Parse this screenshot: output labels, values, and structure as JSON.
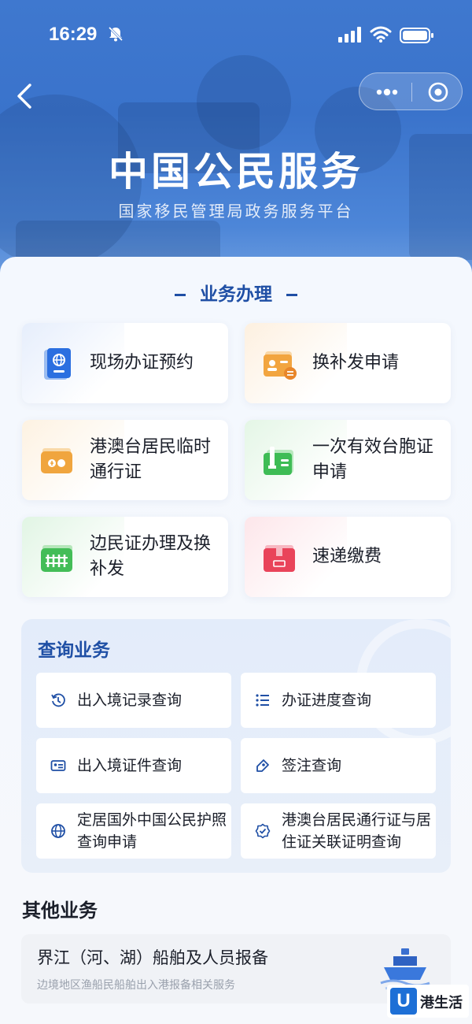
{
  "status_bar": {
    "time": "16:29"
  },
  "header": {
    "title": "中国公民服务",
    "subtitle": "国家移民管理局政务服务平台"
  },
  "business": {
    "section_title": "业务办理",
    "items": [
      {
        "label": "现场办证预约",
        "icon": "passport-icon"
      },
      {
        "label": "换补发申请",
        "icon": "id-card-exchange-icon"
      },
      {
        "label": "港澳台居民临时通行证",
        "icon": "travel-permit-icon"
      },
      {
        "label": "一次有效台胞证申请",
        "icon": "taiwan-permit-icon"
      },
      {
        "label": "边民证办理及换补发",
        "icon": "border-fence-icon"
      },
      {
        "label": "速递缴费",
        "icon": "parcel-icon"
      }
    ]
  },
  "query": {
    "title": "查询业务",
    "items": [
      {
        "label": "出入境记录查询",
        "icon": "history-icon"
      },
      {
        "label": "办证进度查询",
        "icon": "list-check-icon"
      },
      {
        "label": "出入境证件查询",
        "icon": "id-card-icon"
      },
      {
        "label": "签注查询",
        "icon": "tag-icon"
      },
      {
        "label": "定居国外中国公民护照查询申请",
        "icon": "globe-icon"
      },
      {
        "label": "港澳台居民通行证与居住证关联证明查询",
        "icon": "verified-badge-icon"
      }
    ]
  },
  "other": {
    "title": "其他业务",
    "card_title": "界江（河、湖）船舶及人员报备",
    "card_subtitle": "边境地区渔船民船舶出入港报备相关服务"
  },
  "watermark": {
    "text": "港生活"
  },
  "colors": {
    "primary": "#1f4fa5",
    "header": "#3f78cf"
  }
}
